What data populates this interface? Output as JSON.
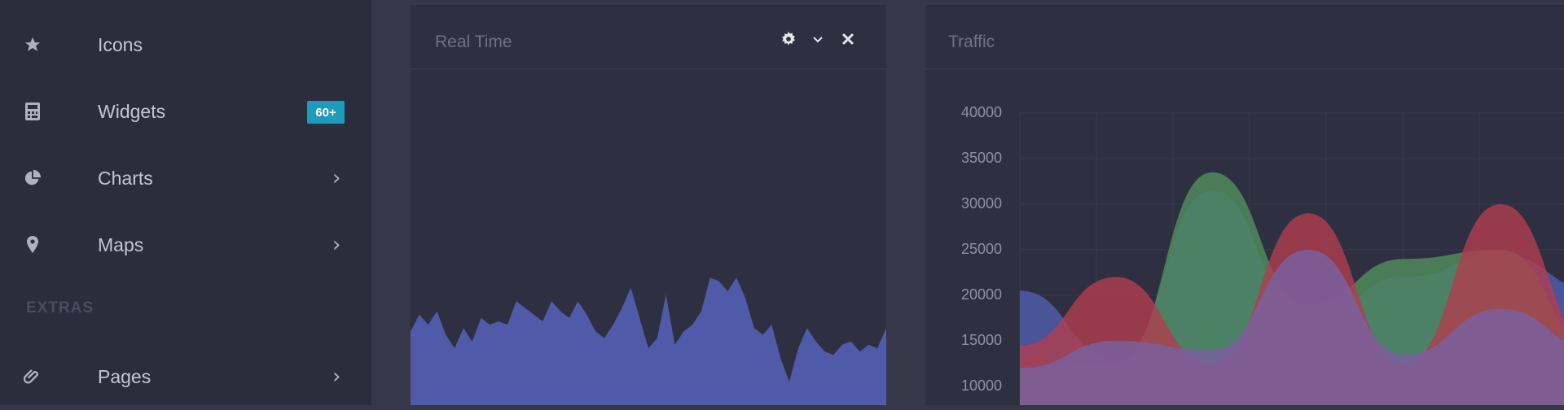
{
  "sidebar": {
    "items": [
      {
        "label": "Icons",
        "icon": "star-icon"
      },
      {
        "label": "Widgets",
        "icon": "calculator-icon",
        "badge": "60+"
      },
      {
        "label": "Charts",
        "icon": "pie-chart-icon"
      },
      {
        "label": "Maps",
        "icon": "map-pin-icon"
      },
      {
        "label": "Pages",
        "icon": "paperclip-icon"
      }
    ],
    "section_label": "EXTRAS"
  },
  "panels": {
    "realtime": {
      "title": "Real Time"
    },
    "traffic": {
      "title": "Traffic"
    }
  },
  "colors": {
    "sidebar_bg": "#2b2d3c",
    "panel_bg": "#2e2f40",
    "badge": "#1e9bb8",
    "series_blue": "#4f5aa8",
    "series_green": "#4e8a5c",
    "series_red": "#b23d4f",
    "series_purple": "#7a5f9e"
  },
  "chart_data": [
    {
      "type": "area",
      "title": "Real Time",
      "values": [
        22,
        27,
        24,
        28,
        21,
        17,
        23,
        19,
        26,
        24,
        25,
        24,
        31,
        29,
        27,
        25,
        31,
        28,
        26,
        31,
        27,
        22,
        20,
        24,
        29,
        35,
        26,
        17,
        20,
        33,
        18,
        22,
        24,
        28,
        38,
        37,
        34,
        38,
        32,
        23,
        21,
        24,
        14,
        7,
        17,
        23,
        19,
        16,
        15,
        18,
        19,
        16,
        18,
        17,
        23
      ]
    },
    {
      "type": "area",
      "title": "Traffic",
      "ylim": [
        10000,
        40000
      ],
      "yticks": [
        10000,
        15000,
        20000,
        25000,
        30000,
        35000,
        40000
      ],
      "x": [
        0,
        1,
        2,
        3,
        4,
        5,
        6
      ],
      "series": [
        {
          "values": [
            20500,
            13000,
            31500,
            17000,
            22000,
            24500,
            20500
          ]
        },
        {
          "values": [
            12000,
            12500,
            33500,
            19000,
            24000,
            25000,
            14000
          ]
        },
        {
          "values": [
            14500,
            22000,
            12500,
            29000,
            12500,
            30000,
            14000
          ]
        },
        {
          "values": [
            12000,
            15000,
            14000,
            25000,
            13500,
            18500,
            14000
          ]
        }
      ]
    }
  ]
}
